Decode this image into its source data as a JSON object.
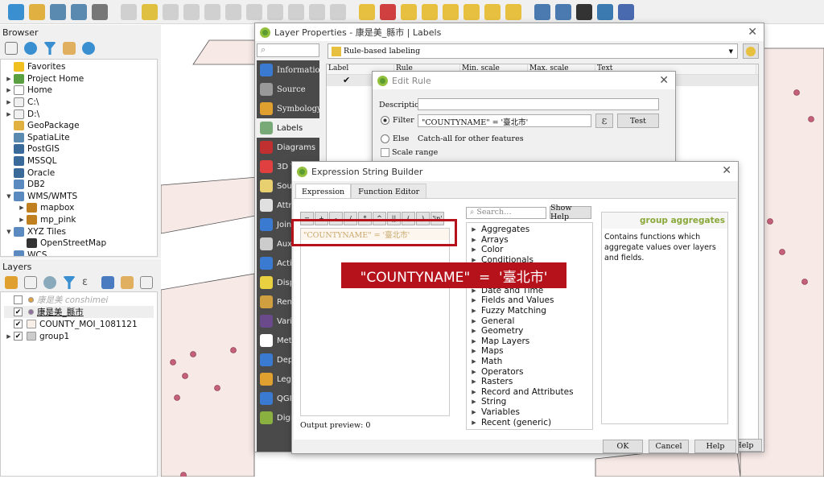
{
  "toolbar": {
    "icons": [
      "new-layer",
      "geopackage",
      "vector",
      "spatialite",
      "virtual",
      "digitize",
      "edit-pencil",
      "save",
      "node",
      "move",
      "delete",
      "cut",
      "copy",
      "paste",
      "undo",
      "redo",
      "label-abc",
      "diagram",
      "label-pin",
      "label-abc-2",
      "label-abc-3",
      "label-abc-4",
      "label-abc-5",
      "label-abc-6",
      "globe-1",
      "globe-2",
      "globe-3",
      "python",
      "help"
    ]
  },
  "browser": {
    "title": "Browser",
    "items": [
      {
        "label": "Favorites",
        "icon": "star",
        "arrow": ""
      },
      {
        "label": "Project Home",
        "icon": "project-home",
        "arrow": "▶"
      },
      {
        "label": "Home",
        "icon": "home",
        "arrow": "▶"
      },
      {
        "label": "C:\\",
        "icon": "folder",
        "arrow": "▶"
      },
      {
        "label": "D:\\",
        "icon": "folder",
        "arrow": "▶"
      },
      {
        "label": "GeoPackage",
        "icon": "geopackage",
        "arrow": ""
      },
      {
        "label": "SpatiaLite",
        "icon": "spatialite",
        "arrow": ""
      },
      {
        "label": "PostGIS",
        "icon": "postgis",
        "arrow": ""
      },
      {
        "label": "MSSQL",
        "icon": "mssql",
        "arrow": ""
      },
      {
        "label": "Oracle",
        "icon": "oracle",
        "arrow": ""
      },
      {
        "label": "DB2",
        "icon": "db2",
        "arrow": ""
      },
      {
        "label": "WMS/WMTS",
        "icon": "globe",
        "arrow": "▼"
      },
      {
        "label": "mapbox",
        "icon": "wms",
        "arrow": "▶",
        "indent": 1
      },
      {
        "label": "mp_pink",
        "icon": "wms",
        "arrow": "▶",
        "indent": 1
      },
      {
        "label": "XYZ Tiles",
        "icon": "globe",
        "arrow": "▼"
      },
      {
        "label": "OpenStreetMap",
        "icon": "tiles",
        "arrow": "",
        "indent": 1
      },
      {
        "label": "WCS",
        "icon": "globe",
        "arrow": ""
      }
    ]
  },
  "layers": {
    "title": "Layers",
    "items": [
      {
        "label": "康是美 conshimei",
        "checked": false,
        "color": "#e0a040"
      },
      {
        "label": "康是美_縣市",
        "checked": true,
        "color": "#9070a0"
      },
      {
        "label": "COUNTY_MOI_1081121",
        "checked": true,
        "color": "#f8efe8"
      },
      {
        "label": "group1",
        "checked": true,
        "color": "#ccc"
      }
    ]
  },
  "layer_props": {
    "title": "Layer Properties - 康是美_縣市 | Labels",
    "mode": "Rule-based labeling",
    "columns": [
      "Label",
      "Rule",
      "Min. scale",
      "Max. scale",
      "Text"
    ],
    "sidebar": [
      "Information",
      "Source",
      "Symbology",
      "Labels",
      "Diagrams",
      "3D View",
      "Source Fields",
      "Attributes Form",
      "Joins",
      "Auxiliary Storage",
      "Actions",
      "Display",
      "Rendering",
      "Variables",
      "Metadata",
      "Dependencies",
      "Legend",
      "QGIS Server",
      "Digitizing"
    ],
    "active": "Labels",
    "help": "Help"
  },
  "edit_rule": {
    "title": "Edit Rule",
    "description_label": "Description",
    "description_value": "",
    "filter_label": "Filter",
    "filter_value": "\"COUNTYNAME\" = '臺北市'",
    "test": "Test",
    "else_label": "Else",
    "else_text": "Catch-all for other features",
    "scale_range": "Scale range"
  },
  "expr": {
    "title": "Expression String Builder",
    "tabs": [
      "Expression",
      "Function Editor"
    ],
    "operators": [
      "=",
      "+",
      "-",
      "/",
      "*",
      "^",
      "||",
      "(",
      ")",
      "'\\n'"
    ],
    "expression": "\"COUNTYNAME\" = '臺北市'",
    "output_preview": "Output preview:  0",
    "search_placeholder": "Search…",
    "show_help": "Show Help",
    "groups": [
      "Aggregates",
      "Arrays",
      "Color",
      "Conditionals",
      "Conversions",
      "Custom",
      "Date and Time",
      "Fields and Values",
      "Fuzzy Matching",
      "General",
      "Geometry",
      "Map Layers",
      "Maps",
      "Math",
      "Operators",
      "Rasters",
      "Record and Attributes",
      "String",
      "Variables",
      "Recent (generic)"
    ],
    "help_title": "group aggregates",
    "help_text": "Contains functions which aggregate values over layers and fields.",
    "ok": "OK",
    "cancel": "Cancel",
    "help": "Help"
  },
  "annotation": {
    "text": "\"COUNTYNAME\"  =  '臺北市'",
    "color": "#b5121b"
  }
}
